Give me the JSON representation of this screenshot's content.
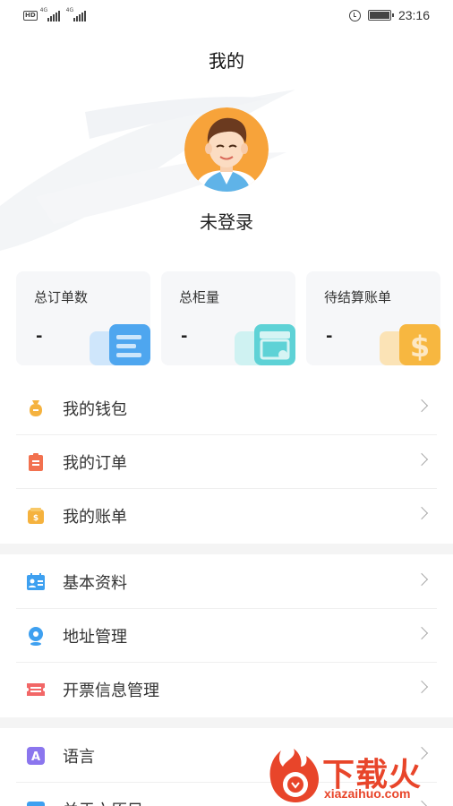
{
  "status_bar": {
    "network_badge": "HD",
    "signal_1_label": "4G",
    "signal_2_label": "4G",
    "time": "23:16",
    "icons": [
      "alarm-icon",
      "battery-icon"
    ]
  },
  "header": {
    "title": "我的"
  },
  "profile": {
    "avatar_icon": "user-avatar-icon",
    "login_status": "未登录"
  },
  "stats": [
    {
      "label": "总订单数",
      "value": "-",
      "icon": "list-doc-icon",
      "color": "#4ea6ef"
    },
    {
      "label": "总柜量",
      "value": "-",
      "icon": "store-icon",
      "color": "#5ed2d6"
    },
    {
      "label": "待结算账单",
      "value": "-",
      "icon": "dollar-icon",
      "color": "#f7b740"
    }
  ],
  "menu": {
    "group1": [
      {
        "label": "我的钱包",
        "icon": "wallet-bag-icon",
        "color": "#f5b23e"
      },
      {
        "label": "我的订单",
        "icon": "clipboard-icon",
        "color": "#f2714f"
      },
      {
        "label": "我的账单",
        "icon": "bill-icon",
        "color": "#f5b23e"
      }
    ],
    "group2": [
      {
        "label": "基本资料",
        "icon": "profile-card-icon",
        "color": "#3ea0f0"
      },
      {
        "label": "地址管理",
        "icon": "location-pin-icon",
        "color": "#3ea0f0"
      },
      {
        "label": "开票信息管理",
        "icon": "ticket-icon",
        "color": "#f26767"
      }
    ],
    "group3": [
      {
        "label": "语言",
        "icon": "language-icon",
        "color": "#8b76ee"
      },
      {
        "label": "关于六原目",
        "icon": "about-icon",
        "color": "#3ea0f0"
      }
    ]
  },
  "watermark": {
    "text": "下载火",
    "url": "xiazaihuo.com"
  }
}
